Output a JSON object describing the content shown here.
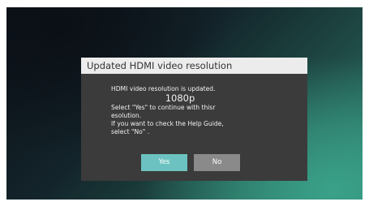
{
  "dialog": {
    "title": "Updated HDMI video resolution",
    "message": {
      "line1": "HDMI video resolution is updated.",
      "resolution": "1080p",
      "line3": "Select \"Yes\" to continue with thisr",
      "line4": "esolution.",
      "line5": "If you want to check the Help Guide,",
      "line6": "select \"No\"  ."
    },
    "buttons": {
      "yes": "Yes",
      "no": "No"
    }
  },
  "colors": {
    "dialog_background": "#3b3b3b",
    "header_background": "#ececec",
    "yes_button": "#6cc2c0",
    "no_button": "#8a8a8a"
  }
}
